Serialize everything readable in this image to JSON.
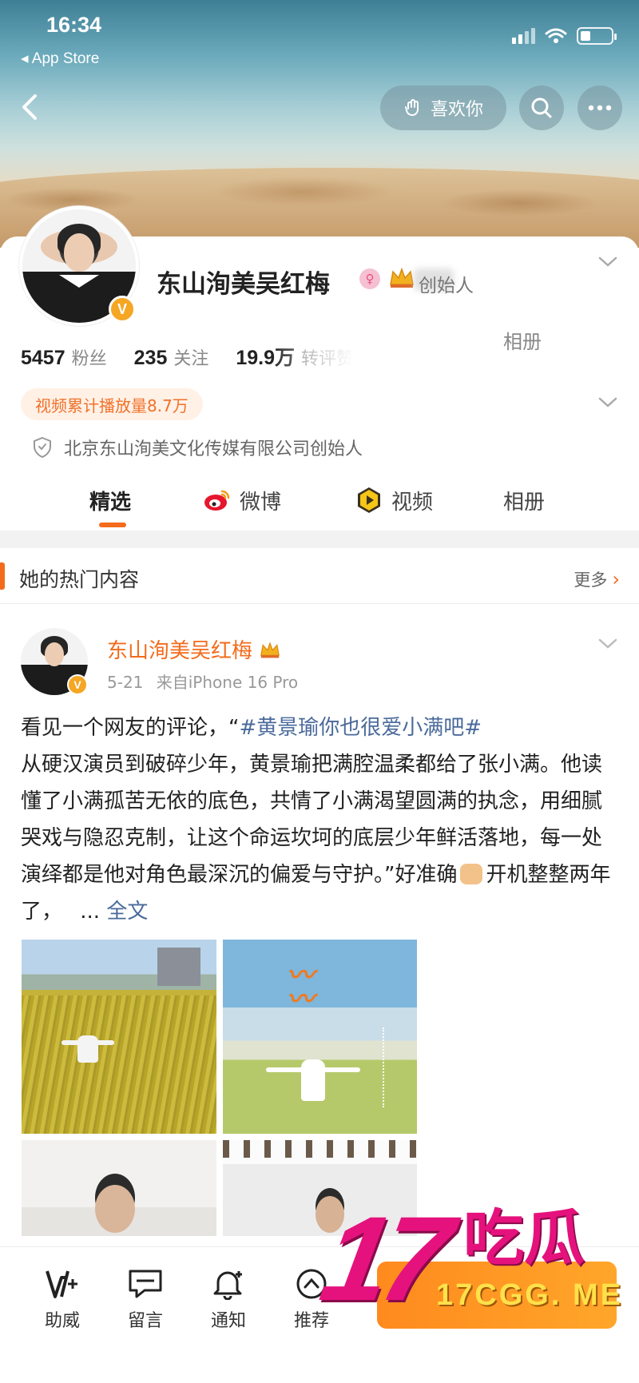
{
  "status_bar": {
    "time": "16:34",
    "back_app": "App Store"
  },
  "nav": {
    "like_button": "喜欢你"
  },
  "profile": {
    "name": "东山洵美吴红梅",
    "title_tag": "创始人",
    "album_link": "相册",
    "stats": [
      {
        "value": "5457",
        "label": "粉丝"
      },
      {
        "value": "235",
        "label": "关注"
      },
      {
        "value": "19.9万",
        "label": "转评赞"
      }
    ],
    "video_plays": "视频累计播放量8.7万",
    "verification": "北京东山洵美文化传媒有限公司创始人"
  },
  "tabs": [
    {
      "label": "精选",
      "active": true
    },
    {
      "label": "微博",
      "icon": "weibo-icon"
    },
    {
      "label": "视频",
      "icon": "video-icon"
    },
    {
      "label": "相册"
    }
  ],
  "hot_section": {
    "title": "她的热门内容",
    "more": "更多"
  },
  "post": {
    "author": "东山洵美吴红梅",
    "date": "5-21",
    "source": "来自iPhone 16 Pro",
    "text_intro": "看见一个网友的评论，“",
    "hashtag": "#黄景瑜你也很爱小满吧#",
    "text_body": "从硬汉演员到破碎少年，黄景瑜把满腔温柔都给了张小满。他读懂了小满孤苦无依的底色，共情了小满渴望圆满的执念，用细腻哭戏与隐忍克制，让这个命运坎坷的底层少年鲜活落地，每一处演绎都是他对角色最深沉的偏爱与守护。”好准确",
    "text_tail": "开机整整两年了，",
    "ellipsis": "...",
    "full_text": "全文",
    "images": [
      "field-photo",
      "poster-photo",
      "room-photo-1",
      "room-photo-2"
    ]
  },
  "bottom_bar": [
    {
      "label": "助威",
      "icon": "cheer-icon"
    },
    {
      "label": "留言",
      "icon": "comment-icon"
    },
    {
      "label": "通知",
      "icon": "bell-icon"
    },
    {
      "label": "推荐",
      "icon": "recommend-icon"
    }
  ],
  "watermark": {
    "big": "17",
    "cn": "吃瓜",
    "url": "17CGG. ME"
  },
  "colors": {
    "accent": "#f36b1c",
    "link": "#4a6a9b",
    "verified": "#f5a623",
    "watermark": "#e5127d"
  }
}
